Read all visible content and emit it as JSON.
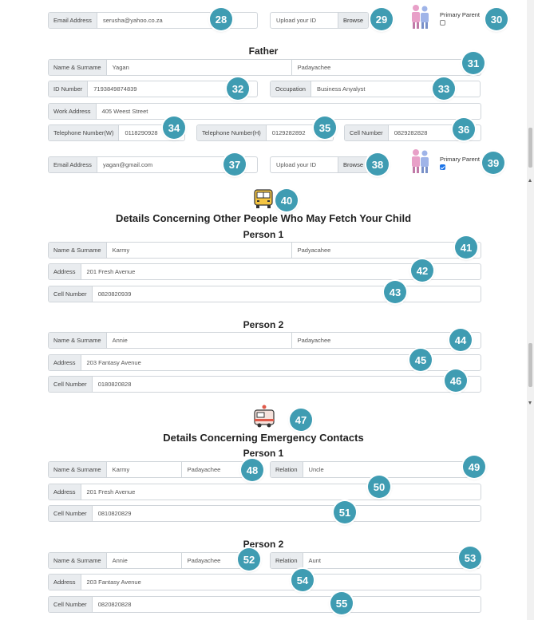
{
  "mother_contact": {
    "email_label": "Email Address",
    "email_value": "serusha@yahoo.co.za",
    "upload_label": "Upload your ID",
    "browse_label": "Browse",
    "primary_parent_label": "Primary Parent",
    "primary_parent_checked": false
  },
  "father": {
    "title": "Father",
    "name_label": "Name & Surname",
    "first_name": "Yagan",
    "surname": "Padayachee",
    "id_label": "ID Number",
    "id_value": "7193849874839",
    "occupation_label": "Occupation",
    "occupation_value": "Business Anyalyst",
    "work_label": "Work Address",
    "work_value": "405 Weest Street",
    "tel_w_label": "Telephone Number(W)",
    "tel_w_value": "0118290928",
    "tel_h_label": "Telephone Number(H)",
    "tel_h_value": "0129282892",
    "cell_label": "Cell Number",
    "cell_value": "0829282828",
    "email_label": "Email Address",
    "email_value": "yagan@gmail.com",
    "upload_label": "Upload your ID",
    "browse_label": "Browse",
    "primary_parent_label": "Primary Parent",
    "primary_parent_checked": true
  },
  "fetch": {
    "title": "Details Concerning Other People Who May Fetch Your Child",
    "icon": "school-bus-icon",
    "person1": {
      "title": "Person 1",
      "name_label": "Name & Surname",
      "first_name": "Karmy",
      "surname": "Padyacahee",
      "address_label": "Address",
      "address_value": "201 Fresh Avenue",
      "cell_label": "Cell Number",
      "cell_value": "0820820939"
    },
    "person2": {
      "title": "Person 2",
      "name_label": "Name & Surname",
      "first_name": "Annie",
      "surname": "Padayachee",
      "address_label": "Address",
      "address_value": "203 Fantasy Avenue",
      "cell_label": "Cell Number",
      "cell_value": "0180820828"
    }
  },
  "emergency": {
    "title": "Details Concerning Emergency Contacts",
    "icon": "ambulance-icon",
    "person1": {
      "title": "Person 1",
      "name_label": "Name & Surname",
      "first_name": "Karmy",
      "surname": "Padayachee",
      "relation_label": "Relation",
      "relation_value": "Uncle",
      "address_label": "Address",
      "address_value": "201 Fresh Avenue",
      "cell_label": "Cell Number",
      "cell_value": "0810820829"
    },
    "person2": {
      "title": "Person 2",
      "name_label": "Name & Surname",
      "first_name": "Annie",
      "surname": "Padayachee",
      "relation_label": "Relation",
      "relation_value": "Aunt",
      "address_label": "Address",
      "address_value": "203 Fantasy Avenue",
      "cell_label": "Cell Number",
      "cell_value": "0820820828"
    }
  },
  "badges": [
    "28",
    "29",
    "30",
    "31",
    "32",
    "33",
    "34",
    "35",
    "36",
    "37",
    "38",
    "39",
    "40",
    "41",
    "42",
    "43",
    "44",
    "45",
    "46",
    "47",
    "48",
    "49",
    "50",
    "51",
    "52",
    "53",
    "54",
    "55"
  ],
  "colors": {
    "badge": "#3f9cb2",
    "label_bg": "#e9ecef",
    "border": "#d0d5da"
  }
}
